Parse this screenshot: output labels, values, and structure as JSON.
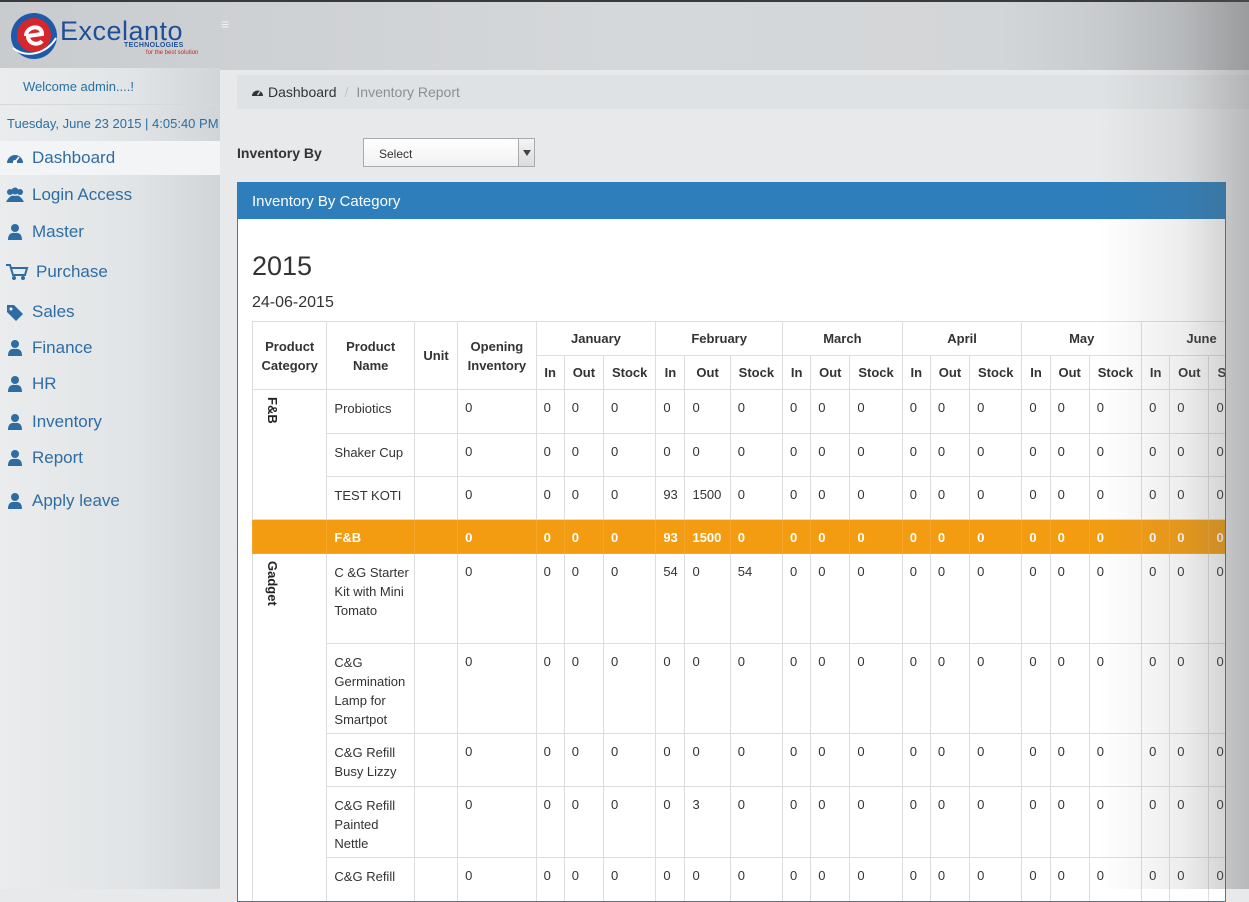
{
  "brand": {
    "name": "Excelanto",
    "sub": "TECHNOLOGIES",
    "tagline": "for the best solution"
  },
  "sidebar": {
    "welcome": "Welcome admin....!",
    "datetime": "Tuesday, June 23 2015 | 4:05:40 PM",
    "items": [
      {
        "label": "Dashboard",
        "icon": "dashboard-icon"
      },
      {
        "label": "Login Access",
        "icon": "users-icon"
      },
      {
        "label": "Master",
        "icon": "user-icon"
      },
      {
        "label": "Purchase",
        "icon": "cart-icon"
      },
      {
        "label": "Sales",
        "icon": "tags-icon"
      },
      {
        "label": "Finance",
        "icon": "user-icon"
      },
      {
        "label": "HR",
        "icon": "user-icon"
      },
      {
        "label": "Inventory",
        "icon": "user-icon"
      },
      {
        "label": "Report",
        "icon": "user-icon"
      },
      {
        "label": "Apply leave",
        "icon": "user-icon"
      }
    ]
  },
  "breadcrumb": {
    "home": "Dashboard",
    "current": "Inventory Report"
  },
  "filter": {
    "label": "Inventory By",
    "value": "Select"
  },
  "panel": {
    "title": "Inventory By Category",
    "year": "2015",
    "date": "24-06-2015",
    "headers": {
      "category": "Product Category",
      "name": "Product Name",
      "unit": "Unit",
      "opening": "Opening Inventory",
      "months": [
        "January",
        "February",
        "March",
        "April",
        "May",
        "June"
      ],
      "sub": [
        "In",
        "Out",
        "Stock"
      ]
    },
    "groups": [
      {
        "category": "F&B",
        "rows": [
          {
            "name": "Probiotics",
            "unit": "",
            "opening": "0",
            "values": [
              "0",
              "0",
              "0",
              "0",
              "0",
              "0",
              "0",
              "0",
              "0",
              "0",
              "0",
              "0",
              "0",
              "0",
              "0",
              "0",
              "0",
              "0"
            ]
          },
          {
            "name": "Shaker Cup",
            "unit": "",
            "opening": "0",
            "values": [
              "0",
              "0",
              "0",
              "0",
              "0",
              "0",
              "0",
              "0",
              "0",
              "0",
              "0",
              "0",
              "0",
              "0",
              "0",
              "0",
              "0",
              "0"
            ]
          },
          {
            "name": "TEST KOTI",
            "unit": "",
            "opening": "0",
            "values": [
              "0",
              "0",
              "0",
              "93",
              "1500",
              "0",
              "0",
              "0",
              "0",
              "0",
              "0",
              "0",
              "0",
              "0",
              "0",
              "0",
              "0",
              "0"
            ]
          }
        ],
        "subtotal": {
          "name": "F&B",
          "opening": "0",
          "values": [
            "0",
            "0",
            "0",
            "93",
            "1500",
            "0",
            "0",
            "0",
            "0",
            "0",
            "0",
            "0",
            "0",
            "0",
            "0",
            "0",
            "0",
            "0"
          ]
        }
      },
      {
        "category": "Gadget",
        "rows": [
          {
            "name": "C &G Starter Kit with Mini Tomato",
            "unit": "",
            "opening": "0",
            "values": [
              "0",
              "0",
              "0",
              "54",
              "0",
              "54",
              "0",
              "0",
              "0",
              "0",
              "0",
              "0",
              "0",
              "0",
              "0",
              "0",
              "0",
              "0"
            ]
          },
          {
            "name": "C&G Germination Lamp for Smartpot",
            "unit": "",
            "opening": "0",
            "values": [
              "0",
              "0",
              "0",
              "0",
              "0",
              "0",
              "0",
              "0",
              "0",
              "0",
              "0",
              "0",
              "0",
              "0",
              "0",
              "0",
              "0",
              "0"
            ]
          },
          {
            "name": "C&G Refill Busy Lizzy",
            "unit": "",
            "opening": "0",
            "values": [
              "0",
              "0",
              "0",
              "0",
              "0",
              "0",
              "0",
              "0",
              "0",
              "0",
              "0",
              "0",
              "0",
              "0",
              "0",
              "0",
              "0",
              "0"
            ]
          },
          {
            "name": "C&G Refill Painted Nettle",
            "unit": "",
            "opening": "0",
            "values": [
              "0",
              "0",
              "0",
              "0",
              "3",
              "0",
              "0",
              "0",
              "0",
              "0",
              "0",
              "0",
              "0",
              "0",
              "0",
              "0",
              "0",
              "0"
            ]
          },
          {
            "name": "C&G Refill",
            "unit": "",
            "opening": "0",
            "values": [
              "0",
              "0",
              "0",
              "0",
              "0",
              "0",
              "0",
              "0",
              "0",
              "0",
              "0",
              "0",
              "0",
              "0",
              "0",
              "0",
              "0",
              "0"
            ]
          }
        ]
      }
    ]
  },
  "colors": {
    "primary": "#2d7ebb",
    "subtotal": "#f39c12",
    "link": "#2e6da4"
  }
}
